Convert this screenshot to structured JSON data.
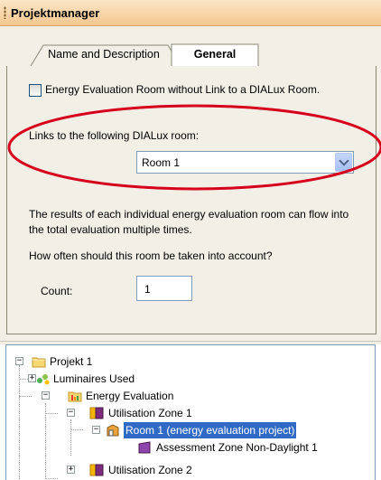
{
  "window": {
    "title": "Projektmanager"
  },
  "tabs": [
    {
      "label": "Name and Description",
      "active": false
    },
    {
      "label": "General",
      "active": true
    }
  ],
  "general": {
    "checkbox_label": "Energy Evaluation Room without Link to a DIALux Room.",
    "checkbox_checked": false,
    "links_label": "Links to the following DIALux room:",
    "room_select_value": "Room 1",
    "info_text": "The results of each individual energy evaluation room can flow into the total evaluation multiple times.",
    "how_often_label": "How often should this room be taken into account?",
    "count_label": "Count:",
    "count_value": "1"
  },
  "annotation": {
    "color": "#d6001c"
  },
  "tree": {
    "nodes": [
      {
        "label": "Projekt 1",
        "icon": "folder-icon",
        "expander": "minus"
      },
      {
        "label": "Luminaires Used",
        "icon": "luminaires-icon",
        "expander": "plus"
      },
      {
        "label": "Energy Evaluation",
        "icon": "energy-folder-icon",
        "expander": "minus"
      },
      {
        "label": "Utilisation Zone 1",
        "icon": "zone-icon",
        "expander": "minus"
      },
      {
        "label": "Room 1 (energy evaluation project)",
        "icon": "room-icon",
        "expander": "minus",
        "selected": true
      },
      {
        "label": "Assessment Zone Non-Daylight 1",
        "icon": "assessment-zone-icon",
        "expander": "none"
      },
      {
        "label": "Utilisation Zone 2",
        "icon": "zone-icon",
        "expander": "plus"
      }
    ]
  },
  "colors": {
    "titlebar": "#f4c78f",
    "panel": "#f1efe6",
    "selection": "#316ac5"
  }
}
